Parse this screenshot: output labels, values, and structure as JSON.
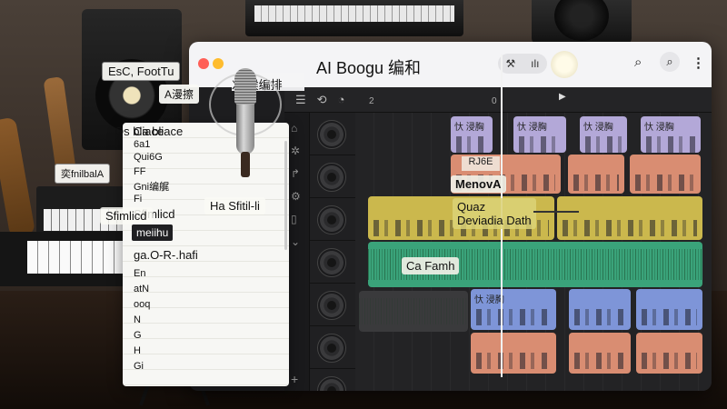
{
  "window": {
    "title": "AI  Boogu 编和",
    "subtitle": "刈 候编排",
    "toolbar": {
      "seg_left_icon": "wand-icon",
      "seg_right_icon": "bars-icon",
      "search_icon": "search-icon",
      "search2_icon": "magnify-icon",
      "more_icon": "more-icon"
    },
    "ruler": [
      "2",
      "0"
    ]
  },
  "tracks": [
    {
      "clips": [
        {
          "label": "忕 浸胸",
          "color": "lav"
        },
        {
          "label": "忕 浸胸",
          "color": "lav"
        },
        {
          "label": "忕 浸胸",
          "color": "lav"
        },
        {
          "label": "忕 浸胸",
          "color": "lav"
        }
      ]
    },
    {
      "clips": [
        {
          "label": "",
          "color": "sal"
        },
        {
          "label": "",
          "color": "sal"
        },
        {
          "label": "",
          "color": "sal"
        }
      ]
    },
    {
      "clips": [
        {
          "label": "",
          "color": "yel"
        },
        {
          "label": "",
          "color": "yel"
        }
      ]
    },
    {
      "clips": [
        {
          "label": "",
          "color": "grn"
        }
      ]
    },
    {
      "clips": [
        {
          "label": "忕 浸胸",
          "color": "blu"
        },
        {
          "label": "",
          "color": "blu"
        },
        {
          "label": "",
          "color": "blu"
        }
      ]
    },
    {
      "clips": [
        {
          "label": "",
          "color": "sal"
        },
        {
          "label": "",
          "color": "sal"
        },
        {
          "label": "",
          "color": "sal"
        }
      ]
    }
  ],
  "annotations": {
    "drop": "RJ6E",
    "clip1": "MenovA",
    "clip2_line1": "Quaz",
    "clip2_line2": "Deviadia Dath",
    "clip3": "Ca Famh"
  },
  "menu": {
    "items": [
      "Ca bliace",
      "6a1",
      "Qui6G",
      "FF",
      "Gni编艉",
      "Fi",
      "Sfimlicd",
      "meiihu",
      "ga.O-R-.hafi",
      "En",
      "atN",
      "ooq",
      "N",
      "G",
      "H",
      "Gi"
    ],
    "selected_index": 7
  },
  "floating_labels": {
    "label1": "EsC, FootTu",
    "label2": "A漫擦",
    "label3": "Os bliace",
    "label4": "奕fnilbalA",
    "label5": "Sfimlicd",
    "label6": "Ha Sfitil-li",
    "label7": "刈 候编排"
  },
  "rail_icons": [
    "home-icon",
    "gear-icon",
    "link-icon",
    "cog-icon",
    "trash-icon",
    "chevron-icon",
    "plus-icon"
  ],
  "colors": {
    "lavender": "#b3a8d8",
    "salmon": "#d98d72",
    "yellow": "#cbb84d",
    "green": "#3aa37a",
    "blue": "#7e95d8"
  }
}
